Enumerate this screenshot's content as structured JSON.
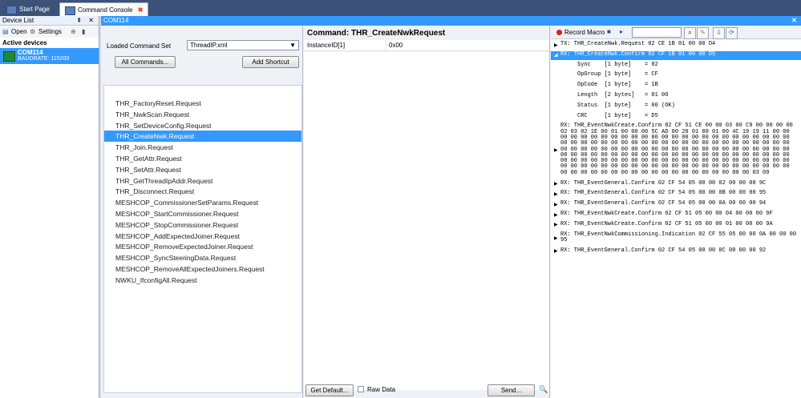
{
  "tabs": [
    {
      "label": "Start Page"
    },
    {
      "label": "Command Console",
      "close": "✖"
    }
  ],
  "device_list": {
    "title": "Device List",
    "controls": "⇞ ✕",
    "open_label": "Open",
    "settings_label": "Settings",
    "active_header": "Active devices",
    "device": {
      "name": "COM114",
      "baud": "BAUDRATE: 115200"
    }
  },
  "console": {
    "title": "COM114",
    "loaded_label": "Loaded Command Set",
    "command_set": "ThreadIP.xml",
    "all_commands": "All Commands...",
    "add_shortcut": "Add Shortcut",
    "commands": [
      "THR_FactoryReset.Request",
      "THR_NwkScan.Request",
      "THR_SetDeviceConfig.Request",
      "THR_CreateNwk.Request",
      "THR_Join.Request",
      "THR_GetAttr.Request",
      "THR_SetAttr.Request",
      "THR_GetThreadIpAddr.Request",
      "THR_Disconnect.Request",
      "MESHCOP_CommissionerSetParams.Request",
      "MESHCOP_StartCommissioner.Request",
      "MESHCOP_StopCommissioner.Request",
      "MESHCOP_AddExpectedJoiner.Request",
      "MESHCOP_RemoveExpectedJoiner.Request",
      "MESHCOP_SyncSteeringData.Request",
      "MESHCOP_RemoveAllExpectedJoiners.Request",
      "NWKU_IfconfigAll.Request"
    ],
    "selected_index": 3,
    "command_title": "Command: THR_CreateNwkRequest",
    "param_name": "InstanceID[1]",
    "param_value": "0x00",
    "get_default": "Get Default...",
    "raw_data": "Raw Data",
    "send": "Send..."
  },
  "log": {
    "record_macro": "Record Macro",
    "lines": [
      {
        "marker": "▶",
        "text": "TX: THR_CreateNwk.Request 02 CE 1B 01 00 00 D4"
      },
      {
        "marker": "◢",
        "text": "RX: THR_CreateNwk.Confirm 02 CF 1B 01 00 00 D5",
        "selected": true
      },
      {
        "marker": "",
        "text": "     Sync    [1 byte]    = 02"
      },
      {
        "marker": "",
        "text": "     OpGroup [1 byte]    = CF"
      },
      {
        "marker": "",
        "text": "     OpCode  [1 byte]    = 1B"
      },
      {
        "marker": "",
        "text": "     Length  [2 bytes]   = 01 00"
      },
      {
        "marker": "",
        "text": "     Status  [1 byte]    = 00 (OK)"
      },
      {
        "marker": "",
        "text": "     CRC     [1 byte]    = D5"
      },
      {
        "marker": "▶",
        "text": "RX: THR_EventNwkCreate.Confirm 02 CF 51 CE 00 00 03 00 C9 00 00 00 00\n02 03 02 1E 00 01 00 00 00 5C AD 00 20 01 00 01 00 4C 19 19 11 00 00\n00 00 00 00 00 00 00 00 00 00 00 00 00 00 00 00 00 00 00 00 00 00 00\n00 00 00 00 00 00 00 00 00 00 00 00 00 00 00 00 00 00 00 00 00 00 00\n00 00 00 00 00 00 00 00 00 00 00 00 00 00 00 00 00 00 00 00 00 00 00\n00 00 00 00 00 00 00 00 00 00 00 00 00 00 00 00 00 00 00 00 00 00 00\n00 00 00 00 00 00 00 00 00 00 00 00 00 00 00 00 00 00 00 00 00 00 00\n00 00 00 00 00 00 00 00 00 00 00 00 00 00 00 00 00 00 00 00 00 00 00\n00 00 00 00 00 00 00 00 00 00 00 00 00 00 00 00 00 00 00 03 09"
      },
      {
        "marker": "▶",
        "text": "RX: THR_EventGeneral.Confirm 02 CF 54 05 00 00 02 00 00 00 9C"
      },
      {
        "marker": "▶",
        "text": "RX: THR_EventGeneral.Confirm 02 CF 54 05 00 00 0B 00 00 00 95"
      },
      {
        "marker": "▶",
        "text": "RX: THR_EventGeneral.Confirm 02 CF 54 05 00 00 0A 00 00 00 94"
      },
      {
        "marker": "▶",
        "text": "RX: THR_EventNwkCreate.Confirm 02 CF 51 05 00 00 04 00 00 00 9F"
      },
      {
        "marker": "▶",
        "text": "RX: THR_EventNwkCreate.Confirm 02 CF 51 05 00 00 01 00 00 00 9A"
      },
      {
        "marker": "▶",
        "text": "RX: THR_EventNwkCommissioning.Indication 02 CF 55 05 00 00 0A 00 00 00\n95"
      },
      {
        "marker": "▶",
        "text": "RX: THR_EventGeneral.Confirm 02 CF 54 05 00 00 0C 00 00 00 92"
      }
    ]
  }
}
